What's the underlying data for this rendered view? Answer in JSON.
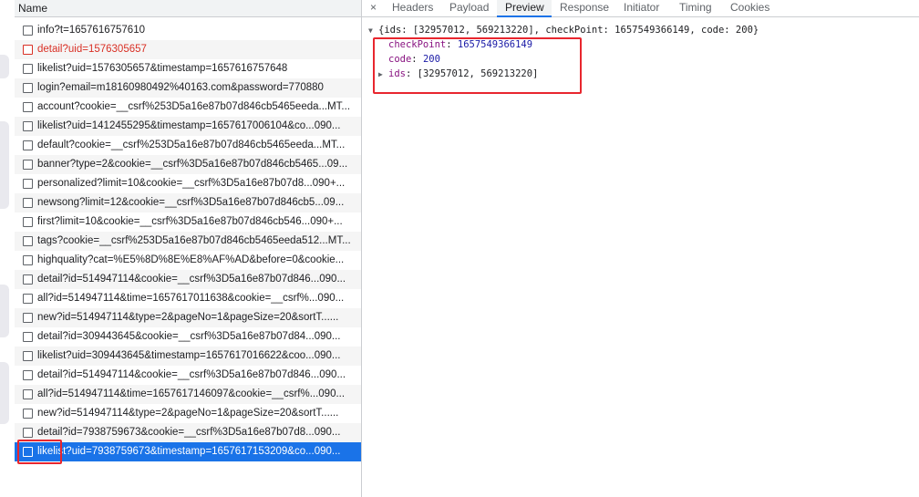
{
  "sidebar_header": "Name",
  "requests": [
    {
      "name": "info?t=1657616757610",
      "status": "normal"
    },
    {
      "name": "detail?uid=1576305657",
      "status": "error"
    },
    {
      "name": "likelist?uid=1576305657&timestamp=1657616757648",
      "status": "normal"
    },
    {
      "name": "login?email=m18160980492%40163.com&password=770880",
      "status": "normal"
    },
    {
      "name": "account?cookie=__csrf%253D5a16e87b07d846cb5465eeda...MT...",
      "status": "normal"
    },
    {
      "name": "likelist?uid=1412455295&timestamp=1657617006104&co...090...",
      "status": "normal"
    },
    {
      "name": "default?cookie=__csrf%253D5a16e87b07d846cb5465eeda...MT...",
      "status": "normal"
    },
    {
      "name": "banner?type=2&cookie=__csrf%3D5a16e87b07d846cb5465...09...",
      "status": "normal"
    },
    {
      "name": "personalized?limit=10&cookie=__csrf%3D5a16e87b07d8...090+...",
      "status": "normal"
    },
    {
      "name": "newsong?limit=12&cookie=__csrf%3D5a16e87b07d846cb5...09...",
      "status": "normal"
    },
    {
      "name": "first?limit=10&cookie=__csrf%3D5a16e87b07d846cb546...090+...",
      "status": "normal"
    },
    {
      "name": "tags?cookie=__csrf%253D5a16e87b07d846cb5465eeda512...MT...",
      "status": "normal"
    },
    {
      "name": "highquality?cat=%E5%8D%8E%E8%AF%AD&before=0&cookie...",
      "status": "normal"
    },
    {
      "name": "detail?id=514947114&cookie=__csrf%3D5a16e87b07d846...090...",
      "status": "normal"
    },
    {
      "name": "all?id=514947114&time=1657617011638&cookie=__csrf%...090...",
      "status": "normal"
    },
    {
      "name": "new?id=514947114&type=2&pageNo=1&pageSize=20&sortT......",
      "status": "normal"
    },
    {
      "name": "detail?id=309443645&cookie=__csrf%3D5a16e87b07d84...090...",
      "status": "normal"
    },
    {
      "name": "likelist?uid=309443645&timestamp=1657617016622&coo...090...",
      "status": "normal"
    },
    {
      "name": "detail?id=514947114&cookie=__csrf%3D5a16e87b07d846...090...",
      "status": "normal"
    },
    {
      "name": "all?id=514947114&time=1657617146097&cookie=__csrf%...090...",
      "status": "normal"
    },
    {
      "name": "new?id=514947114&type=2&pageNo=1&pageSize=20&sortT......",
      "status": "normal"
    },
    {
      "name": "detail?id=7938759673&cookie=__csrf%3D5a16e87b07d8...090...",
      "status": "normal"
    },
    {
      "name": "likelist?uid=7938759673&timestamp=1657617153209&co...090...",
      "status": "selected"
    }
  ],
  "tabs": {
    "close": "×",
    "headers": "Headers",
    "payload": "Payload",
    "preview": "Preview",
    "response": "Response",
    "initiator": "Initiator",
    "timing": "Timing",
    "cookies": "Cookies",
    "active": "Preview"
  },
  "preview": {
    "summary": "{ids: [32957012, 569213220], checkPoint: 1657549366149, code: 200}",
    "checkpoint_key": "checkPoint",
    "checkpoint_value": "1657549366149",
    "code_key": "code",
    "code_value": "200",
    "ids_key": "ids",
    "ids_value": "[32957012, 569213220]"
  },
  "colors": {
    "selected_row": "#1a73e8",
    "error_text": "#d93025",
    "highlight_box": "#e8262e",
    "json_key": "#881280",
    "json_number": "#1a1aa6"
  }
}
